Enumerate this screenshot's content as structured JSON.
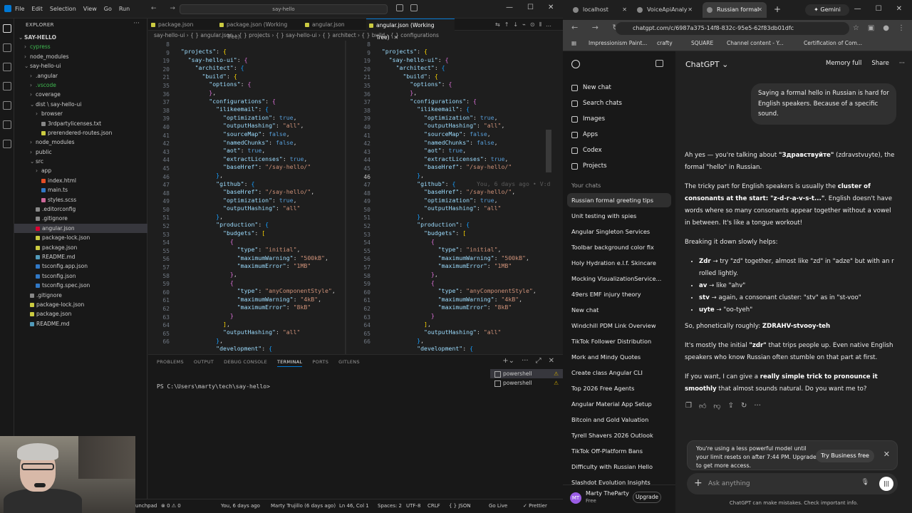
{
  "vscode": {
    "menu": [
      "File",
      "Edit",
      "Selection",
      "View",
      "Go",
      "Run"
    ],
    "search": "say-hello",
    "explorer_title": "EXPLORER",
    "tree": [
      {
        "label": "SAY-HELLO",
        "indent": 0,
        "chev": "⌄",
        "color": "",
        "bold": true
      },
      {
        "label": "cypress",
        "indent": 1,
        "chev": "›",
        "color": "#3fb950"
      },
      {
        "label": "node_modules",
        "indent": 1,
        "chev": "›",
        "color": ""
      },
      {
        "label": "say-hello-ui",
        "indent": 1,
        "chev": "⌄",
        "color": ""
      },
      {
        "label": ".angular",
        "indent": 2,
        "chev": "›",
        "color": ""
      },
      {
        "label": ".vscode",
        "indent": 2,
        "chev": "›",
        "color": "#3fb950"
      },
      {
        "label": "coverage",
        "indent": 2,
        "chev": "›",
        "color": ""
      },
      {
        "label": "dist \\ say-hello-ui",
        "indent": 2,
        "chev": "⌄",
        "color": ""
      },
      {
        "label": "browser",
        "indent": 3,
        "chev": "›",
        "color": ""
      },
      {
        "label": "3rdpartylicenses.txt",
        "indent": 3,
        "chev": "",
        "color": "#888"
      },
      {
        "label": "prerendered-routes.json",
        "indent": 3,
        "chev": "",
        "color": "#cbcb41"
      },
      {
        "label": "node_modules",
        "indent": 2,
        "chev": "›",
        "color": ""
      },
      {
        "label": "public",
        "indent": 2,
        "chev": "›",
        "color": ""
      },
      {
        "label": "src",
        "indent": 2,
        "chev": "⌄",
        "color": ""
      },
      {
        "label": "app",
        "indent": 3,
        "chev": "›",
        "color": ""
      },
      {
        "label": "index.html",
        "indent": 3,
        "chev": "",
        "color": "#e44d26"
      },
      {
        "label": "main.ts",
        "indent": 3,
        "chev": "",
        "color": "#3178c6"
      },
      {
        "label": "styles.scss",
        "indent": 3,
        "chev": "",
        "color": "#cd6799"
      },
      {
        "label": ".editorconfig",
        "indent": 2,
        "chev": "",
        "color": "#888"
      },
      {
        "label": ".gitignore",
        "indent": 2,
        "chev": "",
        "color": "#888"
      },
      {
        "label": "angular.json",
        "indent": 2,
        "chev": "",
        "color": "#dd0031",
        "selected": true
      },
      {
        "label": "package-lock.json",
        "indent": 2,
        "chev": "",
        "color": "#cbcb41"
      },
      {
        "label": "package.json",
        "indent": 2,
        "chev": "",
        "color": "#cbcb41"
      },
      {
        "label": "README.md",
        "indent": 2,
        "chev": "",
        "color": "#519aba"
      },
      {
        "label": "tsconfig.app.json",
        "indent": 2,
        "chev": "",
        "color": "#3178c6"
      },
      {
        "label": "tsconfig.json",
        "indent": 2,
        "chev": "",
        "color": "#3178c6"
      },
      {
        "label": "tsconfig.spec.json",
        "indent": 2,
        "chev": "",
        "color": "#3178c6"
      },
      {
        "label": ".gitignore",
        "indent": 1,
        "chev": "",
        "color": "#888"
      },
      {
        "label": "package-lock.json",
        "indent": 1,
        "chev": "",
        "color": "#cbcb41"
      },
      {
        "label": "package.json",
        "indent": 1,
        "chev": "",
        "color": "#cbcb41"
      },
      {
        "label": "README.md",
        "indent": 1,
        "chev": "",
        "color": "#519aba"
      }
    ],
    "tabs": [
      "package.json",
      "package.json (Working Tree)",
      "angular.json",
      "angular.json (Working Tree)"
    ],
    "breadcrumb": "say-hello-ui  ›  { } angular.json  ›  { } projects  ›  { } say-hello-ui  ›  { } architect  ›  { } build  ›  { } configurations",
    "line_numbers": [
      "8",
      "9",
      "19",
      "20",
      "21",
      "35",
      "36",
      "37",
      "38",
      "39",
      "40",
      "41",
      "42",
      "43",
      "44",
      "45",
      "46",
      "47",
      "48",
      "49",
      "50",
      "51",
      "52",
      "53",
      "54",
      "55",
      "56",
      "57",
      "58",
      "59",
      "60",
      "61",
      "62",
      "63",
      "64",
      "65",
      "66"
    ],
    "blame": "You, 6 days ago • V:d",
    "panel_tabs": [
      "PROBLEMS",
      "OUTPUT",
      "DEBUG CONSOLE",
      "TERMINAL",
      "PORTS",
      "GITLENS"
    ],
    "terminal_prompt": "PS C:\\Users\\marty\\tech\\say-hello>",
    "shells": [
      "powershell",
      "powershell"
    ],
    "status": {
      "left": "unchpad",
      "errors": "⊗ 0  ⚠ 0",
      "blame": "You, 6 days ago",
      "author": "Marty Trujillo (6 days ago)",
      "position": "Ln 46, Col 1",
      "spaces": "Spaces: 2",
      "encoding": "UTF-8",
      "eol": "CRLF",
      "lang": "{ } JSON",
      "golive": "Go Live",
      "prettier": "✓ Prettier"
    }
  },
  "browser": {
    "tabs": [
      "localhost",
      "VoiceApiAnaly",
      "Russian formal"
    ],
    "gemini": "✦ Gemini",
    "url": "chatgpt.com/c/6987a375-14f8-832c-95e5-62f83db01dfc",
    "bookmarks": [
      "Impressionism Paint...",
      "crafty",
      "SQUARE",
      "Channel content - Y...",
      "Certification of Com..."
    ],
    "sidebar": {
      "actions": [
        "New chat",
        "Search chats",
        "Images",
        "Apps",
        "Codex",
        "Projects"
      ],
      "section": "Your chats",
      "chats": [
        "Russian formal greeting tips",
        "Unit testing with spies",
        "Angular Singleton Services",
        "Toolbar background color fix",
        "Holy Hydration e.l.f. Skincare",
        "Mocking VisualizationService...",
        "49ers EMF injury theory",
        "New chat",
        "Windchill PDM Link Overview",
        "TikTok Follower Distribution",
        "Mork and Mindy Quotes",
        "Create class Angular CLI",
        "Top 2026 Free Agents",
        "Angular Material App Setup",
        "Bitcoin and Gold Valuation",
        "Tyrell Shavers 2026 Outlook",
        "TikTok Off-Platform Bans",
        "Difficulty with Russian Hello",
        "Slashdot Evolution Insights"
      ],
      "user_name": "Marty TheParty",
      "user_plan": "Free",
      "upgrade": "Upgrade",
      "avatar": "MT"
    },
    "header": {
      "model": "ChatGPT ⌄",
      "memory": "Memory full",
      "share": "Share"
    },
    "user_message": "Saying a formal hello in Russian is hard for English speakers.  Because of a specific sound.",
    "reply": {
      "p1_a": "Ah yes — you're talking about ",
      "p1_b": "\"Здравствуйте\"",
      "p1_c": " (zdravstvuyte), the formal \"hello\" in Russian.",
      "p2_a": "The tricky part for English speakers is usually the ",
      "p2_b": "cluster of consonants at the start: \"z-d-r-a-v-s-t...\"",
      "p2_c": ". English doesn't have words where so many consonants appear together without a vowel in between. It's like a tongue workout!",
      "p3": "Breaking it down slowly helps:",
      "bullets": [
        {
          "b": "Zdr",
          "t": " → try \"zd\" together, almost like \"zd\" in \"adze\" but with an r rolled lightly."
        },
        {
          "b": "av",
          "t": " → like \"ahv\""
        },
        {
          "b": "stv",
          "t": " → again, a consonant cluster: \"stv\" as in \"st-voo\""
        },
        {
          "b": "uyte",
          "t": " → \"oo-tyeh\""
        }
      ],
      "p4_a": "So, phonetically roughly: ",
      "p4_b": "ZDRAHV-stvooy-teh",
      "p5_a": "It's mostly the initial ",
      "p5_b": "\"zdr\"",
      "p5_c": " that trips people up. Even native English speakers who know Russian often stumble on that part at first.",
      "p6_a": "If you want, I can give a ",
      "p6_b": "really simple trick to pronounce it smoothly",
      "p6_c": " that almost sounds natural. Do you want me to?"
    },
    "notice": "You're using a less powerful model until your limit resets on after 7:44 PM. Upgrade to get more access.",
    "notice_button": "Try Business free",
    "composer_placeholder": "Ask anything",
    "disclaimer": "ChatGPT can make mistakes. Check important info."
  }
}
